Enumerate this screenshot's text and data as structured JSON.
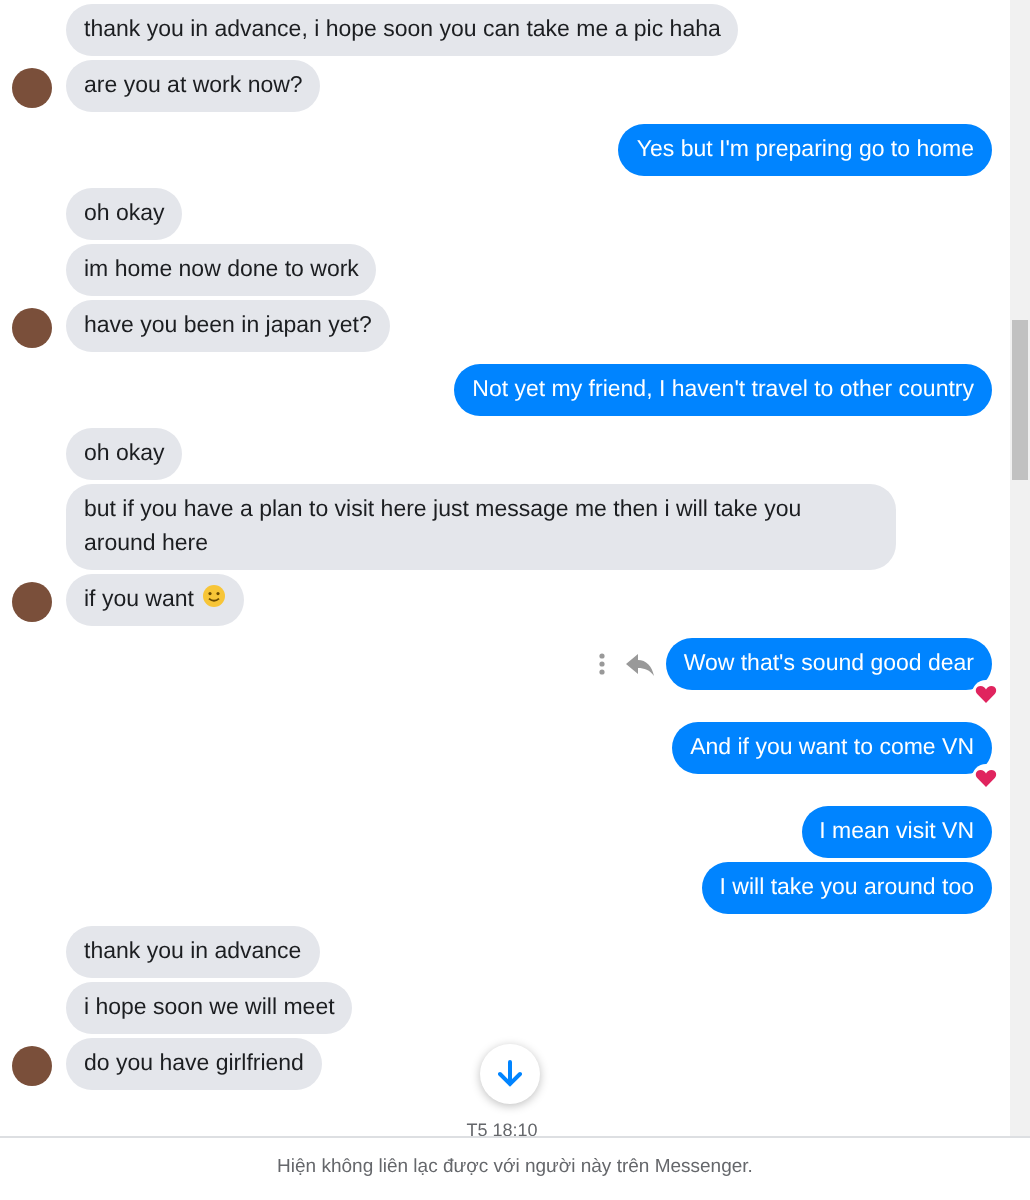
{
  "groups": [
    {
      "kind": "in",
      "messages": [
        {
          "text": "thank you in advance, i hope soon you can take me a pic haha",
          "reacted": false
        },
        {
          "text": "are you at work now?",
          "reacted": false
        }
      ]
    },
    {
      "kind": "out",
      "messages": [
        {
          "text": "Yes but I'm preparing go to home",
          "reacted": false
        }
      ]
    },
    {
      "kind": "in",
      "messages": [
        {
          "text": "oh okay",
          "reacted": false
        },
        {
          "text": "im home now done to work",
          "reacted": false
        },
        {
          "text": "have you been in japan yet?",
          "reacted": false
        }
      ]
    },
    {
      "kind": "out",
      "messages": [
        {
          "text": "Not yet my friend, I haven't travel to other country",
          "reacted": false
        }
      ]
    },
    {
      "kind": "in",
      "messages": [
        {
          "text": "oh okay",
          "reacted": false
        },
        {
          "text": "but if you have a plan to visit here just message me then i will take you around here",
          "reacted": false
        },
        {
          "text": "if you want",
          "smiley": true,
          "reacted": false
        }
      ]
    },
    {
      "kind": "out",
      "messages": [
        {
          "text": "Wow that's sound good dear",
          "reacted": true,
          "actions_shown": true
        },
        {
          "text": "And if you want to come VN",
          "reacted": true
        },
        {
          "text": "I mean visit VN",
          "reacted": false
        },
        {
          "text": "I will take you around too",
          "reacted": false
        }
      ]
    },
    {
      "kind": "in",
      "messages": [
        {
          "text": "thank you in advance",
          "reacted": false
        },
        {
          "text": "i hope soon we will meet",
          "reacted": false
        },
        {
          "text": "do you have girlfriend",
          "reacted": false
        }
      ]
    }
  ],
  "timestamp": "T5 18:10",
  "footer": "Hiện không liên lạc được với người này trên Messenger."
}
